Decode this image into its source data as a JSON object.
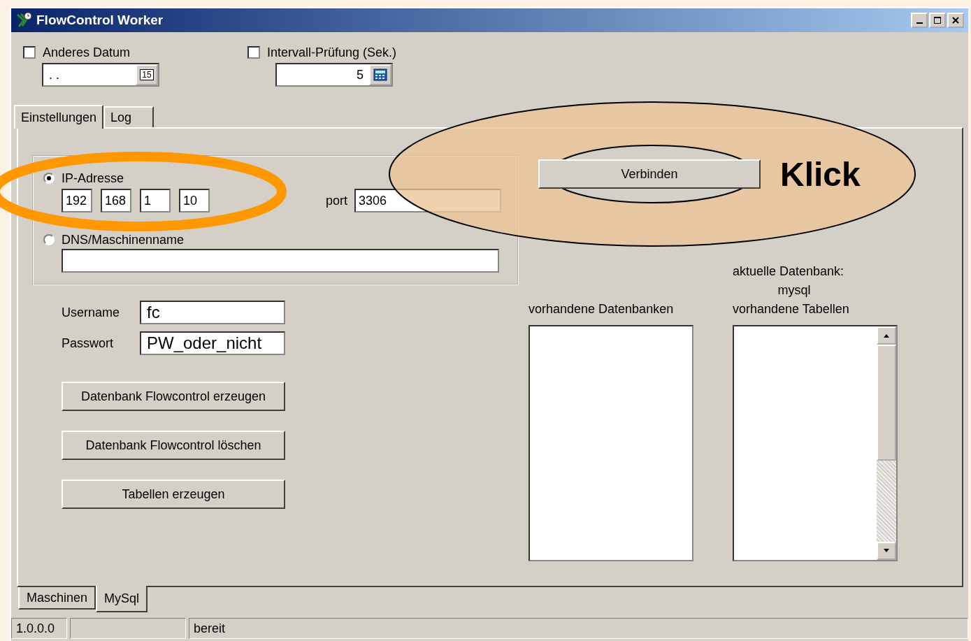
{
  "window": {
    "title": "FlowControl Worker"
  },
  "options": [
    {
      "kind": "date",
      "label": "Anderes Datum",
      "checked": false,
      "value": ". .",
      "button_text": "15"
    },
    {
      "kind": "number",
      "label": "Intervall-Prüfung (Sek.)",
      "checked": false,
      "value": "5"
    }
  ],
  "top_tabs": [
    {
      "label": "Einstellungen",
      "selected": true
    },
    {
      "label": "Log",
      "selected": false
    }
  ],
  "connection": {
    "address_modes": [
      {
        "label": "IP-Adresse",
        "selected": true
      },
      {
        "label": "DNS/Maschinenname",
        "selected": false
      }
    ],
    "ip": [
      "192",
      "168",
      "1",
      "10"
    ],
    "port_label": "port",
    "port": "3306"
  },
  "credentials": [
    {
      "label": "Username",
      "value": "fc"
    },
    {
      "label": "Passwort",
      "value": "PW_oder_nicht"
    }
  ],
  "actions": [
    "Datenbank Flowcontrol erzeugen",
    "Datenbank Flowcontrol löschen",
    "Tabellen erzeugen"
  ],
  "connect_button": "Verbinden",
  "annotation": "Klick",
  "databases": {
    "available_label": "vorhandene Datenbanken",
    "current_label": "aktuelle Datenbank:",
    "current": "mysql",
    "tables_label": "vorhandene Tabellen"
  },
  "bottom_tabs": [
    {
      "label": "Maschinen",
      "selected": false
    },
    {
      "label": "MySql",
      "selected": true
    }
  ],
  "status_bar": {
    "version": "1.0.0.0",
    "message": "bereit"
  }
}
